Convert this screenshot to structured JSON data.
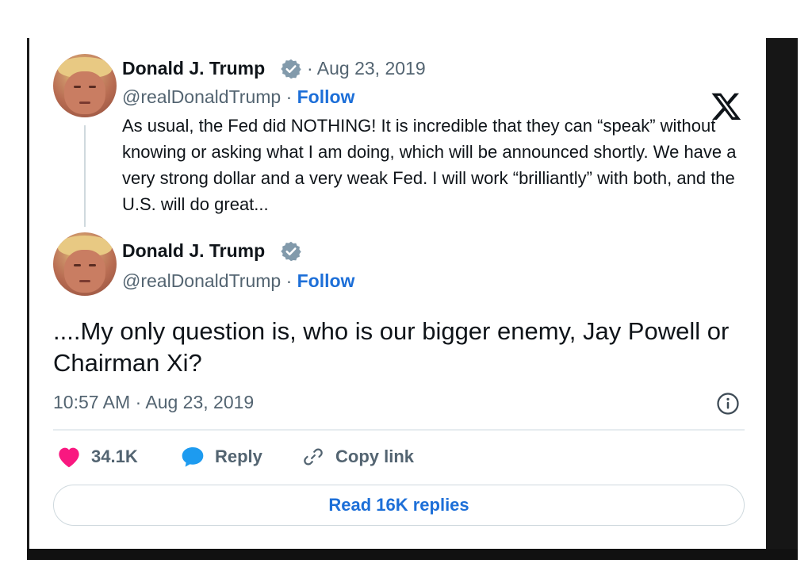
{
  "embed": {
    "parent_tweet": {
      "author_name": "Donald J. Trump",
      "date_meta": "· Aug 23, 2019",
      "handle": "@realDonaldTrump ·",
      "follow_label": "Follow",
      "text": "As usual, the Fed did NOTHING! It is incredible that they can “speak” without knowing or asking what I am doing, which will be announced shortly. We have a very strong dollar and a very weak Fed. I will work “brilliantly” with both, and the U.S. will do great..."
    },
    "main_tweet": {
      "author_name": "Donald J. Trump",
      "handle": "@realDonaldTrump ·",
      "follow_label": "Follow",
      "text": "....My only question is, who is our bigger enemy, Jay Powell or Chairman Xi?",
      "timestamp": "10:57 AM · Aug 23, 2019"
    },
    "actions": {
      "likes": "34.1K",
      "reply_label": "Reply",
      "copy_link_label": "Copy link"
    },
    "read_replies_label": "Read 16K replies",
    "icons": [
      "x-logo-icon",
      "verified-badge-icon",
      "info-icon",
      "heart-icon",
      "reply-bubble-icon",
      "link-icon"
    ],
    "colors": {
      "link_blue": "#1d6fd8",
      "like_pink": "#f91880",
      "reply_blue": "#1d9bf0",
      "muted_text": "#536471",
      "verified_gray": "#829aab"
    }
  }
}
